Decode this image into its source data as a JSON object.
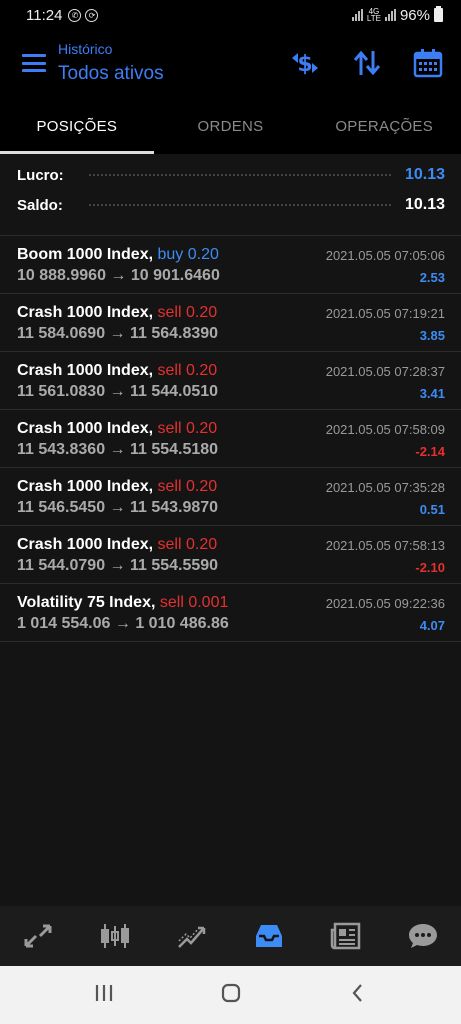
{
  "status_bar": {
    "time": "11:24",
    "battery": "96%",
    "network": "4G",
    "network_sub": "LTE"
  },
  "header": {
    "subtitle": "Histórico",
    "title": "Todos ativos"
  },
  "tabs": [
    {
      "label": "POSIÇÕES",
      "active": true
    },
    {
      "label": "ORDENS",
      "active": false
    },
    {
      "label": "OPERAÇÕES",
      "active": false
    }
  ],
  "summary": {
    "profit_label": "Lucro:",
    "profit_value": "10.13",
    "balance_label": "Saldo:",
    "balance_value": "10.13"
  },
  "trades": [
    {
      "symbol": "Boom 1000 Index,",
      "side": "buy 0.20",
      "prices": "10 888.9960 → 10 901.6460",
      "time": "2021.05.05 07:05:06",
      "profit": "2.53"
    },
    {
      "symbol": "Crash 1000 Index,",
      "side": "sell 0.20",
      "prices": "11 584.0690 → 11 564.8390",
      "time": "2021.05.05 07:19:21",
      "profit": "3.85"
    },
    {
      "symbol": "Crash 1000 Index,",
      "side": "sell 0.20",
      "prices": "11 561.0830 → 11 544.0510",
      "time": "2021.05.05 07:28:37",
      "profit": "3.41"
    },
    {
      "symbol": "Crash 1000 Index,",
      "side": "sell 0.20",
      "prices": "11 543.8360 → 11 554.5180",
      "time": "2021.05.05 07:58:09",
      "profit": "-2.14"
    },
    {
      "symbol": "Crash 1000 Index,",
      "side": "sell 0.20",
      "prices": "11 546.5450 → 11 543.9870",
      "time": "2021.05.05 07:35:28",
      "profit": "0.51"
    },
    {
      "symbol": "Crash 1000 Index,",
      "side": "sell 0.20",
      "prices": "11 544.0790 → 11 554.5590",
      "time": "2021.05.05 07:58:13",
      "profit": "-2.10"
    },
    {
      "symbol": "Volatility 75 Index,",
      "side": "sell 0.001",
      "prices": "1 014 554.06 → 1 010 486.86",
      "time": "2021.05.05 09:22:36",
      "profit": "4.07"
    }
  ],
  "colors": {
    "accent": "#3d7ef5",
    "buy": "#3d8cf5",
    "sell": "#e53030",
    "positive": "#3d8cf5",
    "negative": "#e53030"
  },
  "bottom_nav_icons": [
    "quotes-icon",
    "chart-icon",
    "trade-icon",
    "history-icon",
    "news-icon",
    "messages-icon"
  ],
  "system_nav_icons": [
    "recent-apps-icon",
    "home-icon",
    "back-icon"
  ]
}
